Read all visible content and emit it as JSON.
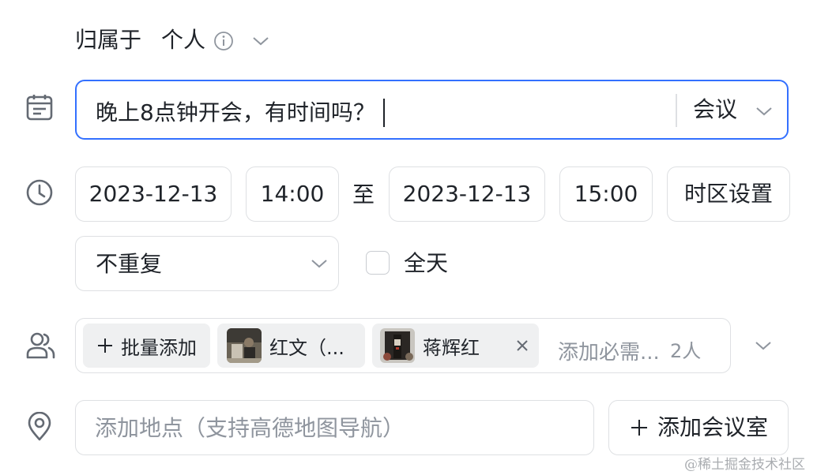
{
  "belongs": {
    "label": "归属于",
    "value": "个人"
  },
  "title_field": {
    "value": "晚上8点钟开会，有时间吗？",
    "type_label": "会议"
  },
  "time": {
    "start_date": "2023-12-13",
    "start_time": "14:00",
    "to_label": "至",
    "end_date": "2023-12-13",
    "end_time": "15:00",
    "timezone_button": "时区设置"
  },
  "repeat": {
    "value": "不重复"
  },
  "all_day": {
    "label": "全天",
    "checked": false
  },
  "attendees": {
    "batch_add_label": "批量添加",
    "chips": [
      {
        "name": "红文（..."
      },
      {
        "name": "蒋辉红"
      }
    ],
    "placeholder": "添加必需...",
    "count": "2人"
  },
  "location": {
    "placeholder": "添加地点（支持高德地图导航）",
    "add_room_label": "添加会议室"
  },
  "watermark": "@稀土掘金技术社区",
  "colors": {
    "accent": "#3370ff",
    "border": "#dee0e3",
    "chip_bg": "#eff0f1",
    "muted": "#8f959e"
  }
}
